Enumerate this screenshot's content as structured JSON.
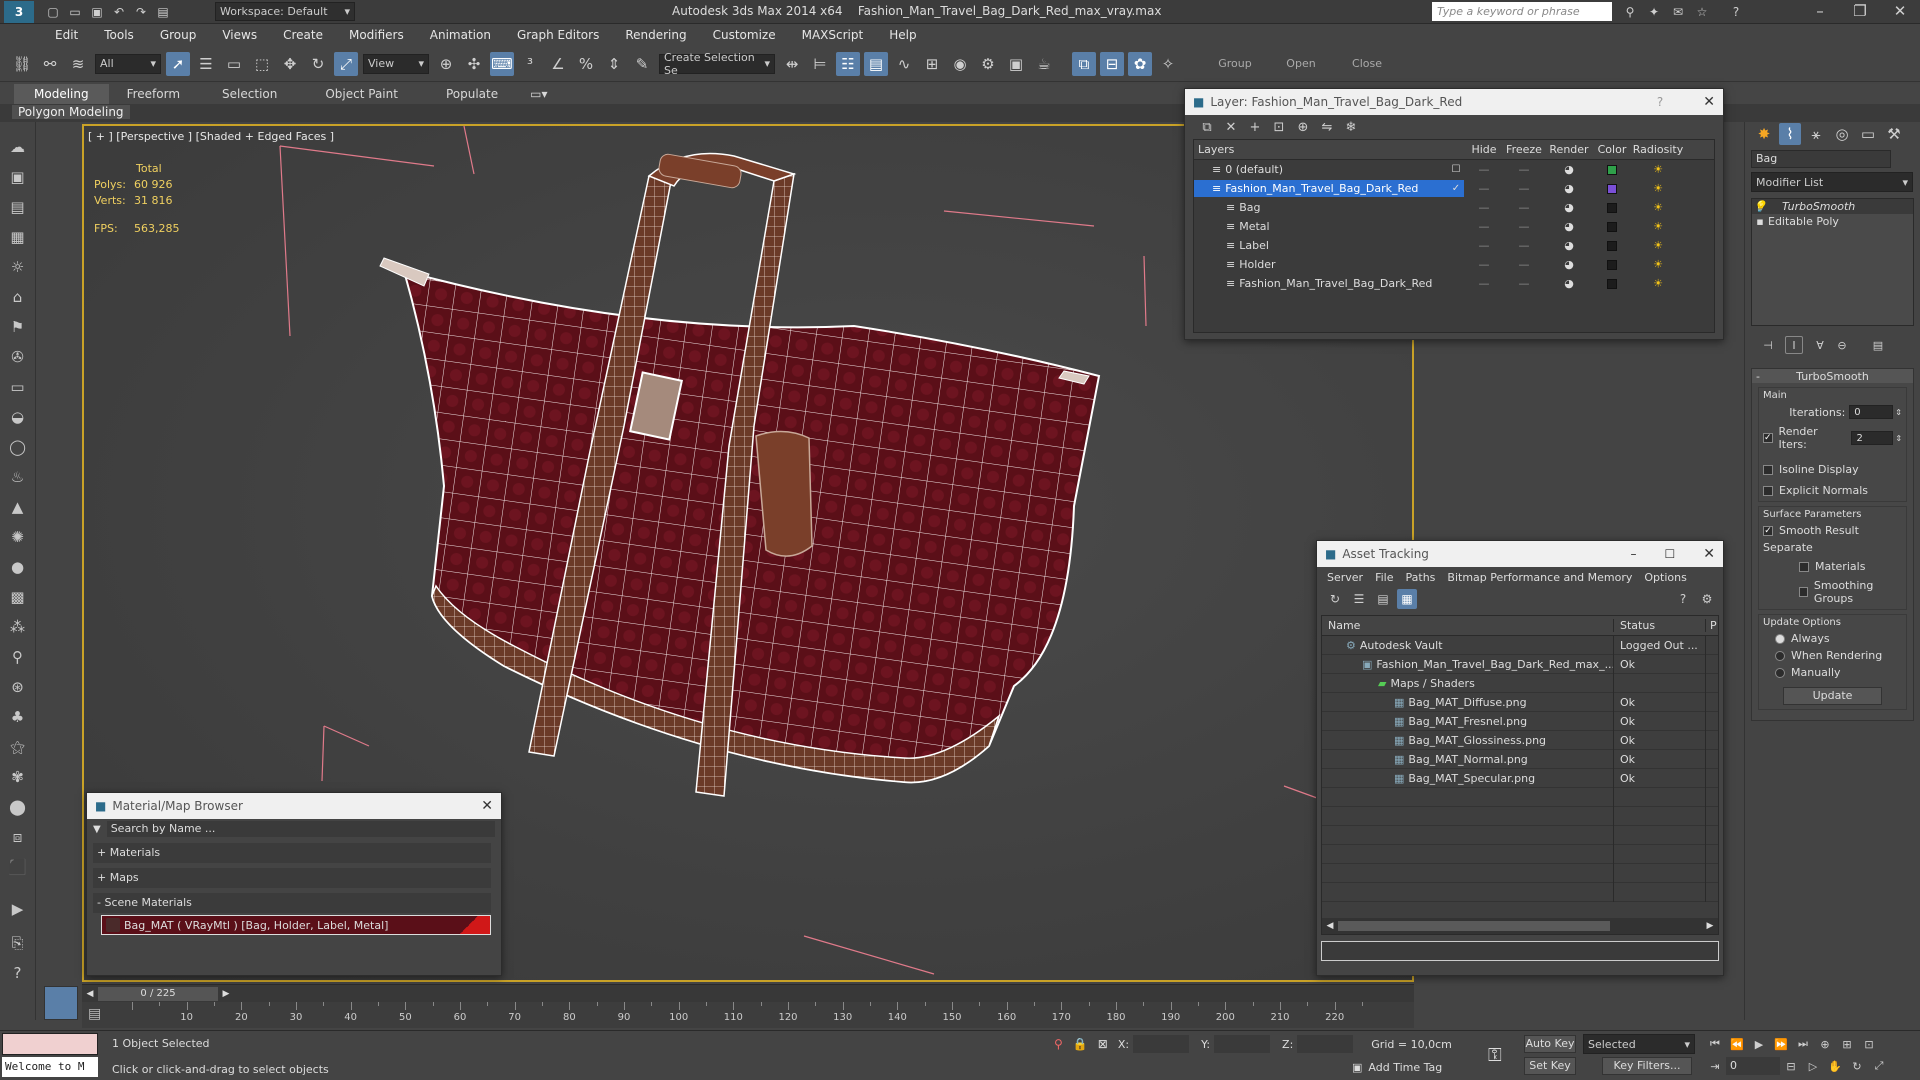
{
  "titlebar": {
    "workspace": "Workspace: Default",
    "app_title": "Autodesk 3ds Max  2014 x64",
    "file_title": "Fashion_Man_Travel_Bag_Dark_Red_max_vray.max",
    "search_placeholder": "Type a keyword or phrase"
  },
  "menu": [
    "Edit",
    "Tools",
    "Group",
    "Views",
    "Create",
    "Modifiers",
    "Animation",
    "Graph Editors",
    "Rendering",
    "Customize",
    "MAXScript",
    "Help"
  ],
  "toolbar": {
    "selection_filter": "All",
    "ref_coord": "View",
    "named_selection_placeholder": "Create Selection Se",
    "group_label": "Group",
    "open_label": "Open",
    "close_label": "Close"
  },
  "ribbon": {
    "tabs": [
      "Modeling",
      "Freeform",
      "Selection",
      "Object Paint",
      "Populate"
    ],
    "active_tab": "Modeling",
    "subtab": "Polygon Modeling"
  },
  "viewport": {
    "label": "[ + ] [Perspective ] [Shaded + Edged Faces ]",
    "stats_total": "Total",
    "polys_label": "Polys:",
    "polys_value": "60 926",
    "verts_label": "Verts:",
    "verts_value": "31 816",
    "fps_label": "FPS:",
    "fps_value": "563,285"
  },
  "layer_dialog": {
    "title": "Layer: Fashion_Man_Travel_Bag_Dark_Red",
    "help": "?",
    "columns": [
      "Layers",
      "Hide",
      "Freeze",
      "Render",
      "Color",
      "Radiosity"
    ],
    "layers": [
      {
        "name": "0 (default)",
        "indent": 0,
        "color": "#2fa04a",
        "selected": false
      },
      {
        "name": "Fashion_Man_Travel_Bag_Dark_Red",
        "indent": 0,
        "color": "#7a4fd6",
        "selected": true
      },
      {
        "name": "Bag",
        "indent": 1,
        "color": "#1c1c1c",
        "selected": false
      },
      {
        "name": "Metal",
        "indent": 1,
        "color": "#1c1c1c",
        "selected": false
      },
      {
        "name": "Label",
        "indent": 1,
        "color": "#1c1c1c",
        "selected": false
      },
      {
        "name": "Holder",
        "indent": 1,
        "color": "#1c1c1c",
        "selected": false
      },
      {
        "name": "Fashion_Man_Travel_Bag_Dark_Red",
        "indent": 1,
        "color": "#1c1c1c",
        "selected": false
      }
    ]
  },
  "material_browser": {
    "title": "Material/Map Browser",
    "search_placeholder": "Search by Name ...",
    "sections": [
      "+ Materials",
      "+ Maps",
      "- Scene Materials"
    ],
    "scene_material": "Bag_MAT  ( VRayMtl ) [Bag, Holder, Label, Metal]"
  },
  "asset_tracking": {
    "title": "Asset Tracking",
    "menu": [
      "Server",
      "File",
      "Paths",
      "Bitmap Performance and Memory",
      "Options"
    ],
    "columns": [
      "Name",
      "Status",
      "P"
    ],
    "rows": [
      {
        "name": "Autodesk Vault",
        "status": "Logged Out ...",
        "level": 0
      },
      {
        "name": "Fashion_Man_Travel_Bag_Dark_Red_max_...",
        "status": "Ok",
        "level": 1
      },
      {
        "name": "Maps / Shaders",
        "status": "",
        "level": 2
      },
      {
        "name": "Bag_MAT_Diffuse.png",
        "status": "Ok",
        "level": 3
      },
      {
        "name": "Bag_MAT_Fresnel.png",
        "status": "Ok",
        "level": 3
      },
      {
        "name": "Bag_MAT_Glossiness.png",
        "status": "Ok",
        "level": 3
      },
      {
        "name": "Bag_MAT_Normal.png",
        "status": "Ok",
        "level": 3
      },
      {
        "name": "Bag_MAT_Specular.png",
        "status": "Ok",
        "level": 3
      }
    ]
  },
  "command_panel": {
    "object_name": "Bag",
    "modifier_list": "Modifier List",
    "stack": [
      "TurboSmooth",
      "Editable Poly"
    ],
    "rollout_title": "TurboSmooth",
    "main_label": "Main",
    "iterations_label": "Iterations:",
    "iterations_value": "0",
    "render_iters_label": "Render Iters:",
    "render_iters_value": "2",
    "isoline": "Isoline Display",
    "explicit_normals": "Explicit Normals",
    "surface_params": "Surface Parameters",
    "smooth_result": "Smooth Result",
    "separate": "Separate",
    "materials": "Materials",
    "smoothing_groups": "Smoothing Groups",
    "update_options": "Update Options",
    "always": "Always",
    "when_rendering": "When Rendering",
    "manually": "Manually",
    "update_btn": "Update"
  },
  "timeline": {
    "frame_counter": "0 / 225",
    "ticks": [
      "10",
      "20",
      "30",
      "40",
      "50",
      "60",
      "70",
      "80",
      "90",
      "100",
      "110",
      "120",
      "130",
      "140",
      "150",
      "160",
      "170",
      "180",
      "190",
      "200",
      "210",
      "220"
    ]
  },
  "status": {
    "welcome": "Welcome to M",
    "selected": "1 Object Selected",
    "prompt": "Click or click-and-drag to select objects",
    "x_label": "X:",
    "y_label": "Y:",
    "z_label": "Z:",
    "grid": "Grid = 10,0cm",
    "auto_key": "Auto Key",
    "set_key": "Set Key",
    "key_mode": "Selected",
    "key_filters": "Key Filters...",
    "add_time_tag": "Add Time Tag",
    "frame": "0"
  }
}
